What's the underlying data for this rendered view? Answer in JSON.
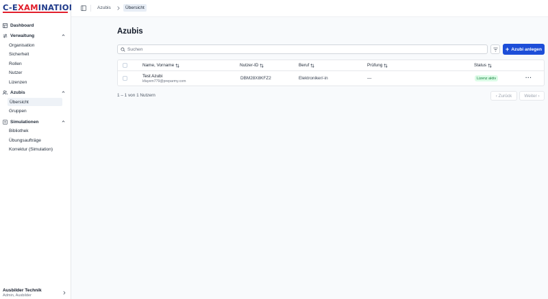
{
  "logo": {
    "part1": "C-E",
    "part2": "XAM",
    "part3": "INATION"
  },
  "sidebar": {
    "dashboard": "Dashboard",
    "verwaltung": {
      "label": "Verwaltung",
      "items": [
        "Organisation",
        "Sicherheit",
        "Rollen",
        "Nutzer",
        "Lizenzen"
      ]
    },
    "azubis": {
      "label": "Azubis",
      "items": [
        "Übersicht",
        "Gruppen"
      ]
    },
    "simulationen": {
      "label": "Simulationen",
      "items": [
        "Bibliothek",
        "Übungsaufträge",
        "Korrektur (Simulation)"
      ]
    },
    "user": {
      "name": "Ausbilder Technik",
      "role": "Admin, Ausbilder"
    }
  },
  "breadcrumb": {
    "parent": "Azubis",
    "current": "Übersicht"
  },
  "page": {
    "title": "Azubis"
  },
  "search": {
    "placeholder": "Suchen",
    "value": ""
  },
  "actions": {
    "add_label": "Azubi anlegen"
  },
  "table": {
    "headers": {
      "name": "Name, Vorname",
      "id": "Nutzer-ID",
      "beruf": "Beruf",
      "pruefung": "Prüfung",
      "status": "Status"
    },
    "rows": [
      {
        "name": "Test Azubi",
        "email": "kfayem779@preparmy.com",
        "id": "DBM28X8KFZ2",
        "beruf": "Elektroniker/-in",
        "pruefung": "—",
        "status": "Lizenz aktiv"
      }
    ]
  },
  "pagination": {
    "info": "1 – 1 von 1 Nutzern",
    "prev": "‹ Zurück",
    "next": "Weiter ›"
  },
  "colors": {
    "primary": "#1d4ed8",
    "logo_blue": "#1f3a8a",
    "logo_red": "#e11d2a",
    "badge_bg": "#dcfce7",
    "badge_text": "#15803d"
  }
}
